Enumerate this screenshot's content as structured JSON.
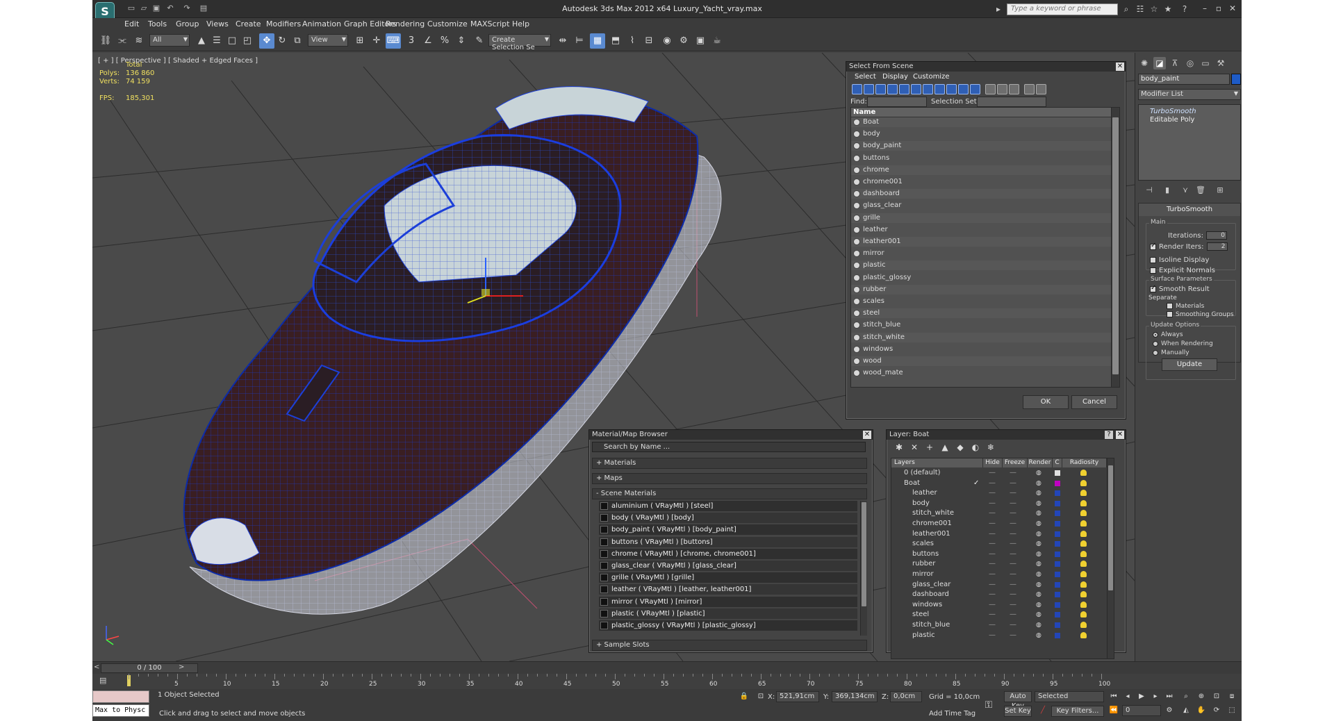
{
  "window": {
    "title": "Autodesk 3ds Max  2012 x64    Luxury_Yacht_vray.max",
    "search_placeholder": "Type a keyword or phrase",
    "logo_icon": "3dsmax-logo-icon"
  },
  "menu": [
    "Edit",
    "Tools",
    "Group",
    "Views",
    "Create",
    "Modifiers",
    "Animation",
    "Graph Editors",
    "Rendering",
    "Customize",
    "MAXScript",
    "Help"
  ],
  "toolbar": {
    "filter": "All",
    "ref_coord": "View",
    "selection_set": "Create Selection Se"
  },
  "viewport": {
    "label": "[ + ] [ Perspective ] [ Shaded + Edged Faces ]",
    "stats": {
      "total_label": "Total",
      "polys_label": "Polys:",
      "polys": "136 860",
      "verts_label": "Verts:",
      "verts": "74 159",
      "fps_label": "FPS:",
      "fps": "185,301"
    }
  },
  "command_panel": {
    "object_name": "body_paint",
    "object_color": "#1e5bc6",
    "modifier_list": "Modifier List",
    "stack": [
      "TurboSmooth",
      "Editable Poly"
    ],
    "rollout_title": "TurboSmooth",
    "main_label": "Main",
    "iterations_label": "Iterations:",
    "iterations": "0",
    "render_iters_label": "Render Iters:",
    "render_iters": "2",
    "isoline_label": "Isoline Display",
    "explicit_label": "Explicit Normals",
    "surface_label": "Surface Parameters",
    "smooth_label": "Smooth Result",
    "separate_label": "Separate",
    "materials_label": "Materials",
    "smoothing_label": "Smoothing Groups",
    "update_label": "Update Options",
    "always_label": "Always",
    "when_rendering_label": "When Rendering",
    "manually_label": "Manually",
    "update_button": "Update"
  },
  "select_from_scene": {
    "title": "Select From Scene",
    "menus": [
      "Select",
      "Display",
      "Customize"
    ],
    "find_label": "Find:",
    "selection_set_label": "Selection Set:",
    "column_name": "Name",
    "items": [
      "Boat",
      "body",
      "body_paint",
      "buttons",
      "chrome",
      "chrome001",
      "dashboard",
      "glass_clear",
      "grille",
      "leather",
      "leather001",
      "mirror",
      "plastic",
      "plastic_glossy",
      "rubber",
      "scales",
      "steel",
      "stitch_blue",
      "stitch_white",
      "windows",
      "wood",
      "wood_mate"
    ],
    "ok": "OK",
    "cancel": "Cancel"
  },
  "material_browser": {
    "title": "Material/Map Browser",
    "search_placeholder": "Search by Name ...",
    "sections": [
      "+ Materials",
      "+ Maps",
      "- Scene Materials"
    ],
    "materials": [
      "aluminium  ( VRayMtl ) [steel]",
      "body  ( VRayMtl ) [body]",
      "body_paint  ( VRayMtl ) [body_paint]",
      "buttons  ( VRayMtl ) [buttons]",
      "chrome  ( VRayMtl ) [chrome, chrome001]",
      "glass_clear  ( VRayMtl ) [glass_clear]",
      "grille  ( VRayMtl ) [grille]",
      "leather  ( VRayMtl ) [leather, leather001]",
      "mirror  ( VRayMtl ) [mirror]",
      "plastic  ( VRayMtl ) [plastic]",
      "plastic_glossy  ( VRayMtl ) [plastic_glossy]"
    ],
    "sample_slots": "+ Sample Slots"
  },
  "layer_dialog": {
    "title": "Layer: Boat",
    "help": "?",
    "columns": [
      "Layers",
      "Hide",
      "Freeze",
      "Render",
      "C",
      "Radiosity"
    ],
    "layers": [
      {
        "name": "0 (default)",
        "level": 0,
        "color": "#e0e0e0"
      },
      {
        "name": "Boat",
        "level": 0,
        "color": "#c000c0",
        "active": true
      },
      {
        "name": "leather",
        "level": 1,
        "color": "#2346b8"
      },
      {
        "name": "body",
        "level": 1,
        "color": "#2346b8"
      },
      {
        "name": "stitch_white",
        "level": 1,
        "color": "#2346b8"
      },
      {
        "name": "chrome001",
        "level": 1,
        "color": "#2346b8"
      },
      {
        "name": "leather001",
        "level": 1,
        "color": "#2346b8"
      },
      {
        "name": "scales",
        "level": 1,
        "color": "#2346b8"
      },
      {
        "name": "buttons",
        "level": 1,
        "color": "#2346b8"
      },
      {
        "name": "rubber",
        "level": 1,
        "color": "#2346b8"
      },
      {
        "name": "mirror",
        "level": 1,
        "color": "#2346b8"
      },
      {
        "name": "glass_clear",
        "level": 1,
        "color": "#2346b8"
      },
      {
        "name": "dashboard",
        "level": 1,
        "color": "#2346b8"
      },
      {
        "name": "windows",
        "level": 1,
        "color": "#2346b8"
      },
      {
        "name": "steel",
        "level": 1,
        "color": "#2346b8"
      },
      {
        "name": "stitch_blue",
        "level": 1,
        "color": "#2346b8"
      },
      {
        "name": "plastic",
        "level": 1,
        "color": "#2346b8"
      }
    ]
  },
  "timeline": {
    "frame": "0 / 100",
    "ticks": [
      "5",
      "10",
      "15",
      "20",
      "25",
      "30",
      "35",
      "40",
      "45",
      "50",
      "55",
      "60",
      "65",
      "70",
      "75",
      "80",
      "85",
      "90",
      "95",
      "100"
    ]
  },
  "statusbar": {
    "maxscript": "Max to Physc",
    "selected": "1 Object Selected",
    "prompt": "Click and drag to select and move objects",
    "x_label": "X:",
    "x": "521,91cm",
    "y_label": "Y:",
    "y": "369,134cm",
    "z_label": "Z:",
    "z": "0,0cm",
    "grid": "Grid = 10,0cm",
    "add_time_tag": "Add Time Tag",
    "auto_key": "Auto Key",
    "set_key": "Set Key",
    "key_mode": "Selected",
    "key_filters": "Key Filters...",
    "frame_field": "0"
  }
}
